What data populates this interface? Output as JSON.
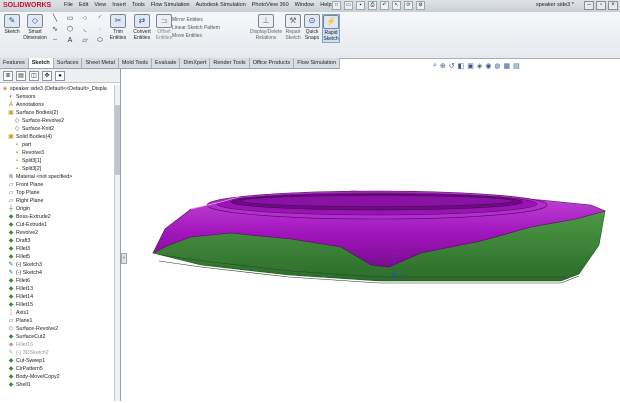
{
  "app": {
    "logo": "SOLIDWORKS",
    "document_title": "speaker side3 *"
  },
  "menu": [
    "File",
    "Edit",
    "View",
    "Insert",
    "Tools",
    "Flow Simulation",
    "Autodesk Simulation",
    "PhotoView 360",
    "Window",
    "Help"
  ],
  "ribbon": {
    "sketch": "Sketch",
    "smart_dimension_1": "Smart",
    "smart_dimension_2": "Dimension",
    "trim_1": "Trim",
    "trim_2": "Entities",
    "convert_1": "Convert",
    "convert_2": "Entities",
    "offset_1": "Offset",
    "offset_2": "Entities",
    "mirror": "Mirror Entities",
    "linear_pattern": "Linear Sketch Pattern",
    "move": "Move Entities",
    "display_delete_1": "Display/Delete",
    "display_delete_2": "Relations",
    "repair_1": "Repair",
    "repair_2": "Sketch",
    "quick_snaps_1": "Quick",
    "quick_snaps_2": "Snaps",
    "rapid_sketch_1": "Rapid",
    "rapid_sketch_2": "Sketch"
  },
  "tabs": [
    "Features",
    "Sketch",
    "Surfaces",
    "Sheet Metal",
    "Mold Tools",
    "Evaluate",
    "DimXpert",
    "Render Tools",
    "Office Products",
    "Flow Simulation"
  ],
  "active_tab": "Sketch",
  "tree": [
    {
      "text": "speaker side3  (Default<<Default>_Displa",
      "indent": 0,
      "icon": "part-icon",
      "dim": false
    },
    {
      "text": "Sensors",
      "indent": 1,
      "icon": "sensor-icon",
      "dim": false
    },
    {
      "text": "Annotations",
      "indent": 1,
      "icon": "annotation-icon",
      "dim": false
    },
    {
      "text": "Surface Bodies(2)",
      "indent": 1,
      "icon": "folder-icon",
      "dim": false
    },
    {
      "text": "Surface-Revolve2",
      "indent": 2,
      "icon": "surface-icon",
      "dim": false
    },
    {
      "text": "Surface-Knit2",
      "indent": 2,
      "icon": "surface-icon",
      "dim": false
    },
    {
      "text": "Solid Bodies(4)",
      "indent": 1,
      "icon": "folder-icon",
      "dim": false
    },
    {
      "text": "part",
      "indent": 2,
      "icon": "body-icon",
      "dim": false
    },
    {
      "text": "Revolve3",
      "indent": 2,
      "icon": "body-icon",
      "dim": false
    },
    {
      "text": "Split3[1]",
      "indent": 2,
      "icon": "body-icon",
      "dim": false
    },
    {
      "text": "Split3[2]",
      "indent": 2,
      "icon": "body-icon",
      "dim": false
    },
    {
      "text": "Material <not specified>",
      "indent": 1,
      "icon": "material-icon",
      "dim": false
    },
    {
      "text": "Front Plane",
      "indent": 1,
      "icon": "plane-icon",
      "dim": false
    },
    {
      "text": "Top Plane",
      "indent": 1,
      "icon": "plane-icon",
      "dim": false
    },
    {
      "text": "Right Plane",
      "indent": 1,
      "icon": "plane-icon",
      "dim": false
    },
    {
      "text": "Origin",
      "indent": 1,
      "icon": "origin-icon",
      "dim": false
    },
    {
      "text": "Boss-Extrude2",
      "indent": 1,
      "icon": "feature-icon",
      "dim": false
    },
    {
      "text": "Cut-Extrude1",
      "indent": 1,
      "icon": "feature-icon",
      "dim": false
    },
    {
      "text": "Revolve2",
      "indent": 1,
      "icon": "feature-icon",
      "dim": false
    },
    {
      "text": "Draft3",
      "indent": 1,
      "icon": "feature-icon",
      "dim": false
    },
    {
      "text": "Fillet3",
      "indent": 1,
      "icon": "feature-icon",
      "dim": false
    },
    {
      "text": "Fillet5",
      "indent": 1,
      "icon": "feature-icon",
      "dim": false
    },
    {
      "text": "(-) Sketch3",
      "indent": 1,
      "icon": "sketch-icon",
      "dim": false
    },
    {
      "text": "(-) Sketch4",
      "indent": 1,
      "icon": "sketch-icon",
      "dim": false
    },
    {
      "text": "Fillet6",
      "indent": 1,
      "icon": "feature-icon",
      "dim": false
    },
    {
      "text": "Fillet13",
      "indent": 1,
      "icon": "feature-icon",
      "dim": false
    },
    {
      "text": "Fillet14",
      "indent": 1,
      "icon": "feature-icon",
      "dim": false
    },
    {
      "text": "Fillet15",
      "indent": 1,
      "icon": "feature-icon",
      "dim": false
    },
    {
      "text": "Axis1",
      "indent": 1,
      "icon": "axis-icon",
      "dim": false
    },
    {
      "text": "Plane1",
      "indent": 1,
      "icon": "plane-icon",
      "dim": false
    },
    {
      "text": "Surface-Revolve2",
      "indent": 1,
      "icon": "surface-icon",
      "dim": false
    },
    {
      "text": "SurfaceCut2",
      "indent": 1,
      "icon": "feature-icon",
      "dim": false
    },
    {
      "text": "Fillet16",
      "indent": 1,
      "icon": "feature-icon",
      "dim": true
    },
    {
      "text": "(-) 3DSketch2",
      "indent": 1,
      "icon": "sketch-icon",
      "dim": true
    },
    {
      "text": "Cut-Sweep1",
      "indent": 1,
      "icon": "feature-icon",
      "dim": false
    },
    {
      "text": "CirPattern5",
      "indent": 1,
      "icon": "feature-icon",
      "dim": false
    },
    {
      "text": "Body-Move/Copy2",
      "indent": 1,
      "icon": "feature-icon",
      "dim": false
    },
    {
      "text": "Shell1",
      "indent": 1,
      "icon": "feature-icon",
      "dim": false
    }
  ],
  "colors": {
    "model_top": "#a215bd",
    "model_side": "#3f8a3a",
    "accent": "#c8102e"
  },
  "view_icons": [
    "zoom-fit-icon",
    "zoom-area-icon",
    "previous-view-icon",
    "section-view-icon",
    "view-orientation-icon",
    "display-style-icon",
    "hide-show-icon",
    "edit-appearance-icon",
    "scene-icon",
    "view-settings-icon"
  ]
}
